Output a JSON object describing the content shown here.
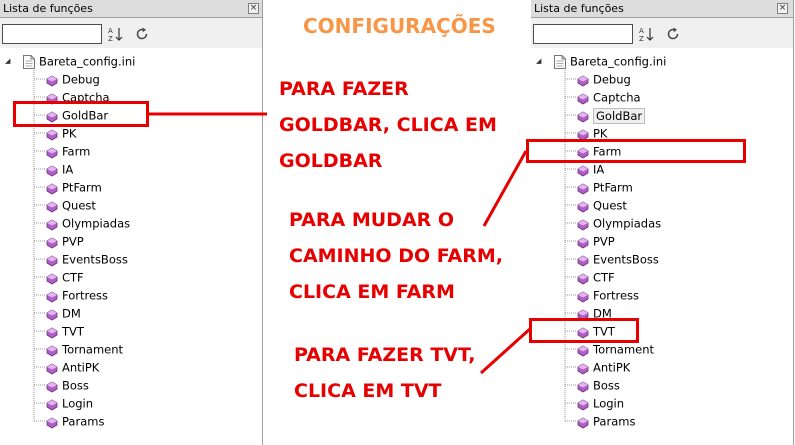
{
  "heading": "CONFIGURAÇÕES",
  "panel": {
    "title": "Lista de funções",
    "close_glyph": "×",
    "search_value": "",
    "root_label": "Bareta_config.ini",
    "items": [
      "Debug",
      "Captcha",
      "GoldBar",
      "PK",
      "Farm",
      "IA",
      "PtFarm",
      "Quest",
      "Olympiadas",
      "PVP",
      "EventsBoss",
      "CTF",
      "Fortress",
      "DM",
      "TVT",
      "Tornament",
      "AntiPK",
      "Boss",
      "Login",
      "Params"
    ],
    "selected_item": "GoldBar",
    "icons": {
      "sort": "sort-az-icon",
      "refresh": "refresh-icon",
      "file": "ini-file-icon",
      "item": "function-icon"
    }
  },
  "annotations": {
    "goldbar": [
      "PARA FAZER",
      "GOLDBAR, CLICA EM",
      "GOLDBAR"
    ],
    "farm": [
      "PARA MUDAR O",
      "CAMINHO DO FARM,",
      "CLICA EM FARM"
    ],
    "tvt": [
      "PARA FAZER TVT,",
      "CLICA EM TVT"
    ]
  },
  "colors": {
    "annotation_red": "#e60000",
    "heading_orange": "#f79646",
    "item_icon_purple": "#b05fc7"
  }
}
